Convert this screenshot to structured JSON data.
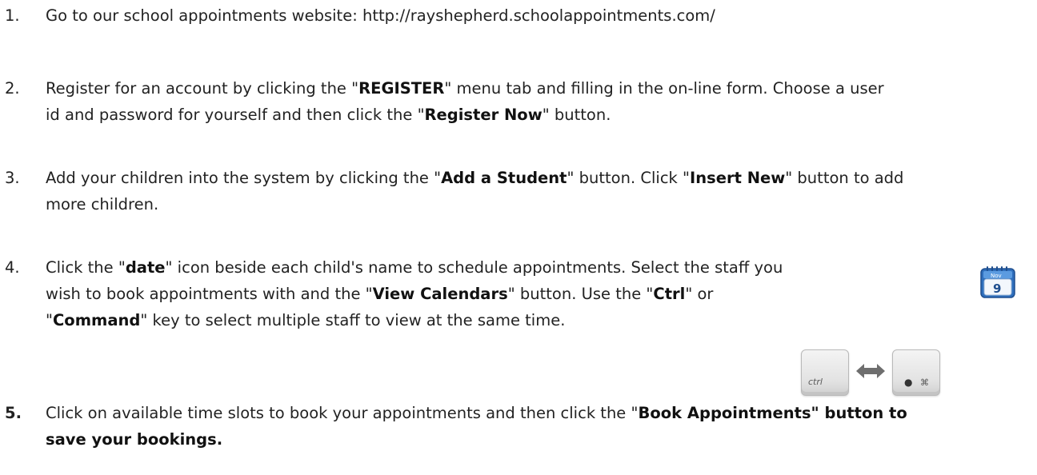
{
  "steps": [
    {
      "number": "1.",
      "text": "Go to our school appointments website:  http://rayshepherd.schoolappointments.com/"
    },
    {
      "number": "2.",
      "line1_a": "Register for an account by clicking the \"",
      "line1_b": "REGISTER",
      "line1_c": "\" menu tab and filling in the on-line form.  Choose a user",
      "line2_a": "id and password for yourself and then click the \"",
      "line2_b": "Register Now",
      "line2_c": "\" button."
    },
    {
      "number": "3.",
      "line1_a": "Add your children into the system by clicking the \"",
      "line1_b": "Add a Student",
      "line1_c": "\" button.  Click \"",
      "line1_d": "Insert New",
      "line1_e": "\" button to add",
      "line2": "more children."
    },
    {
      "number": "4.",
      "line1_a": "Click the \"",
      "line1_b": "date",
      "line1_c": "\" icon beside each child's name to schedule appointments.  Select the staff you",
      "line2_a": "wish to book appointments with and the \"",
      "line2_b": "View Calendars",
      "line2_c": "\" button.  Use the \"",
      "line2_d": "Ctrl",
      "line2_e": "\" or",
      "line3_a": "\"",
      "line3_b": "Command",
      "line3_c": "\" key to select multiple staff to view at the same time."
    },
    {
      "number": "5.",
      "line1_a": "Click on available time slots to book your appointments and then click the \"",
      "line1_b": "Book Appointments\" button to",
      "line2": "save your bookings."
    }
  ],
  "calendar_icon": {
    "icon": "calendar-icon",
    "month": "Nov",
    "day": "9"
  },
  "keys": {
    "ctrl_label": "ctrl",
    "apple_symbol": "",
    "command_symbol": "⌘"
  },
  "colors": {
    "text": "#222222",
    "calendar_blue": "#3a7cc9"
  }
}
